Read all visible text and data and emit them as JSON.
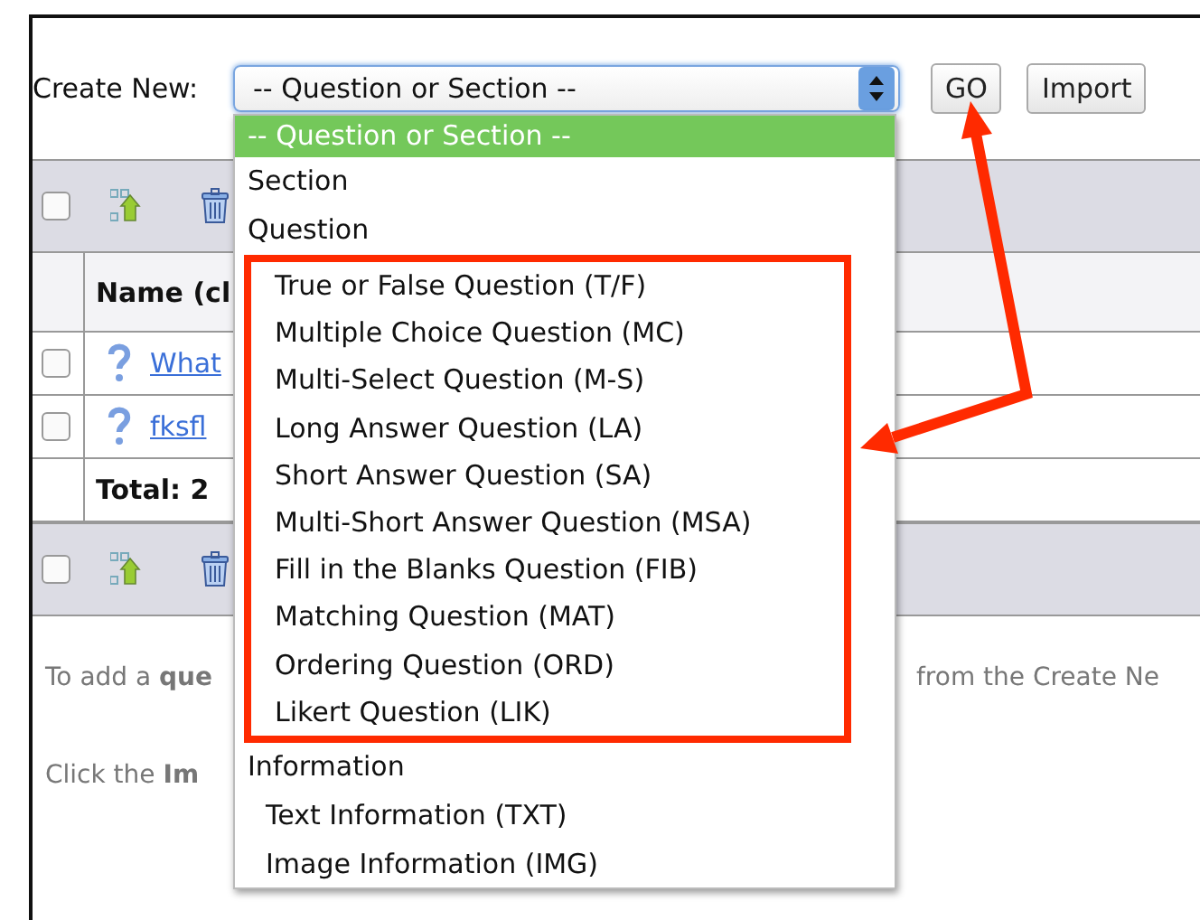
{
  "create_new": {
    "label": "Create New:",
    "select_value": "-- Question or Section --",
    "buttons": [
      "GO",
      "Import"
    ]
  },
  "table": {
    "toolbars": [
      {
        "checked": false
      },
      {
        "checked": false
      }
    ],
    "header": "Name (cl",
    "rows": [
      {
        "name": "What",
        "checked": false
      },
      {
        "name": "fksfl",
        "checked": false
      }
    ],
    "total": "Total: 2"
  },
  "help": [
    {
      "left": "To add a **que**",
      "right": "from the Create Ne"
    },
    {
      "left": "Click the **Im**"
    }
  ],
  "dropdown": {
    "options": [
      {
        "kind": "placeholder",
        "label": "-- Question or Section --",
        "selected": true
      },
      {
        "kind": "group",
        "label": "Section",
        "selected": false
      },
      {
        "kind": "group",
        "label": "Question",
        "selected": false,
        "highlighted": true,
        "children": [
          {
            "label": "True or False Question (T/F)",
            "selected": false
          },
          {
            "label": "Multiple Choice Question (MC)",
            "selected": false
          },
          {
            "label": "Multi-Select Question (M-S)",
            "selected": false
          },
          {
            "label": "Long Answer Question (LA)",
            "selected": false
          },
          {
            "label": "Short Answer Question (SA)",
            "selected": false
          },
          {
            "label": "Multi-Short Answer Question (MSA)",
            "selected": false
          },
          {
            "label": "Fill in the Blanks Question (FIB)",
            "selected": false
          },
          {
            "label": "Matching Question (MAT)",
            "selected": false
          },
          {
            "label": "Ordering Question (ORD)",
            "selected": false
          },
          {
            "label": "Likert Question (LIK)",
            "selected": false
          }
        ]
      },
      {
        "kind": "group",
        "label": "Information",
        "selected": false,
        "highlighted": false,
        "children": [
          {
            "label": "Text Information (TXT)",
            "selected": false
          },
          {
            "label": "Image Information (IMG)",
            "selected": false
          }
        ]
      }
    ]
  }
}
